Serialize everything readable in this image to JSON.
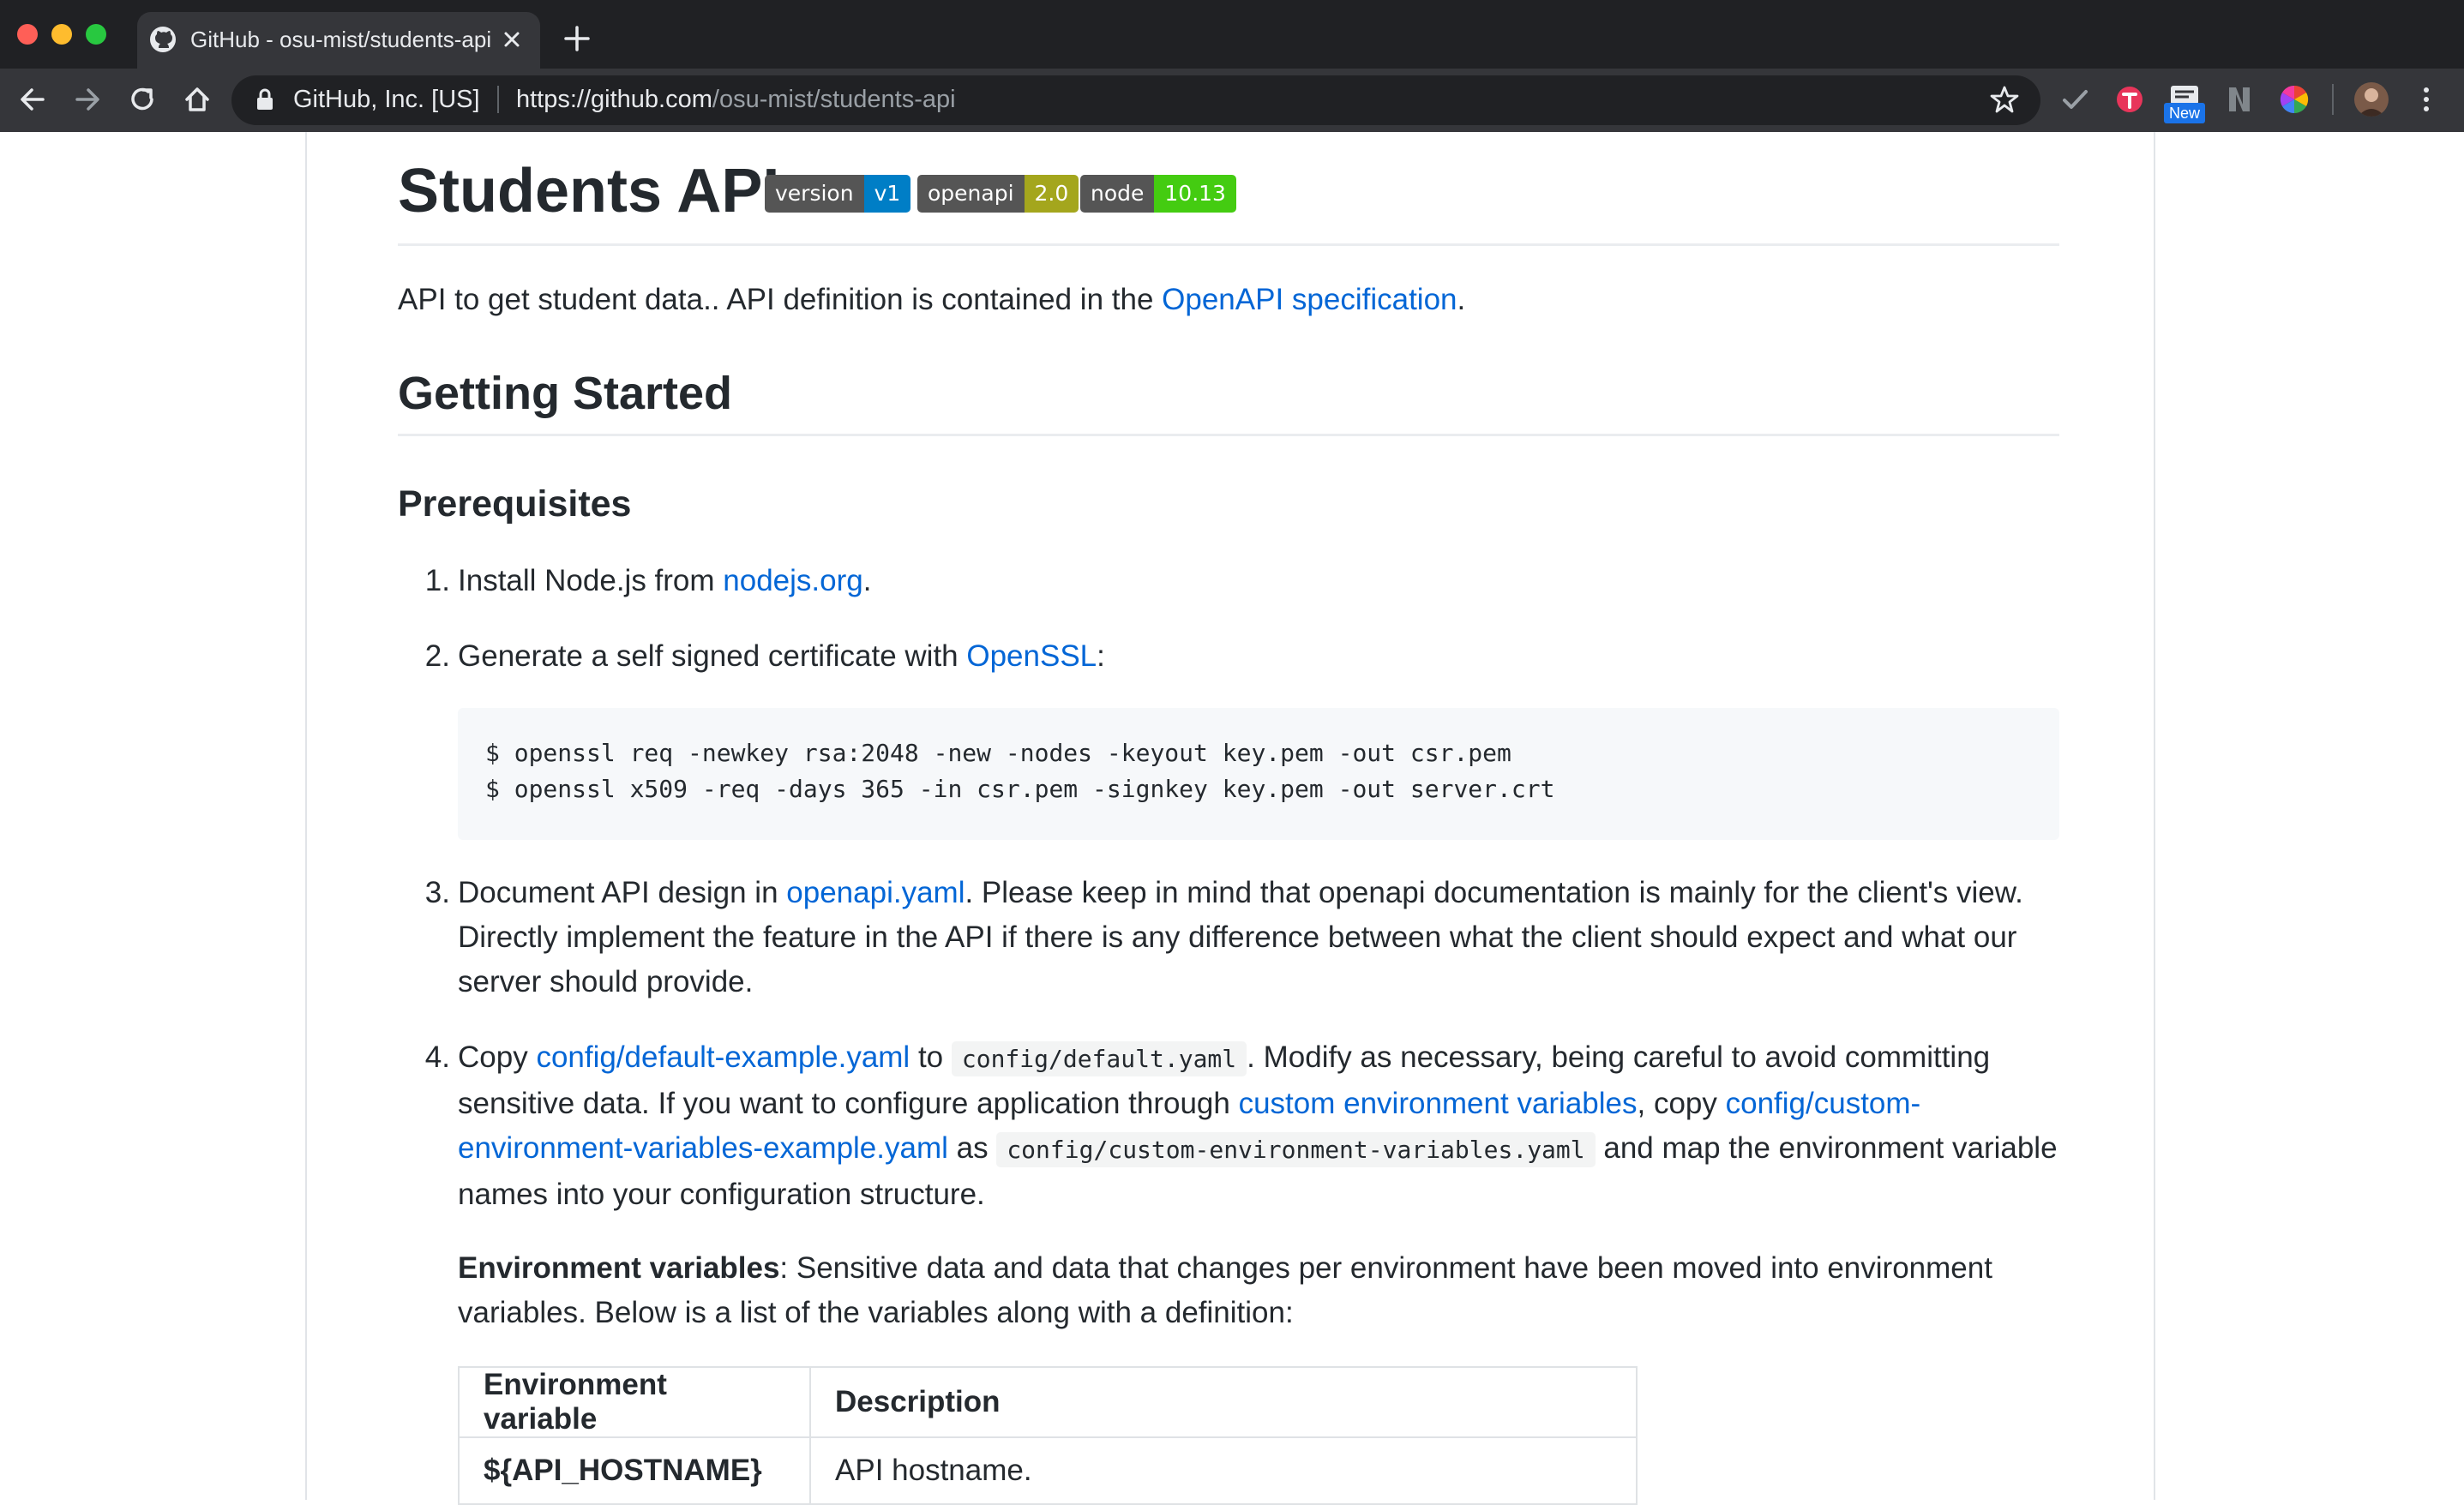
{
  "browser": {
    "tab": {
      "title": "GitHub - osu-mist/students-api"
    },
    "site_identity": "GitHub, Inc. [US]",
    "url": {
      "scheme_host": "https://github.com",
      "path": "/osu-mist/students-api"
    },
    "extensions": [
      {
        "icon": "check-extension-icon"
      },
      {
        "icon": "red-circle-extension-icon"
      },
      {
        "icon": "new-extension-icon",
        "badge": "New"
      },
      {
        "icon": "n-extension-icon"
      },
      {
        "icon": "color-wheel-extension-icon"
      }
    ],
    "colors": {
      "frame": "#202124",
      "toolbar": "#35363a"
    }
  },
  "readme": {
    "title": "Students API",
    "badges": [
      {
        "label": "version",
        "value": "v1",
        "color": "#007ec6"
      },
      {
        "label": "openapi",
        "value": "2.0",
        "color": "#a4a61d"
      },
      {
        "label": "node",
        "value": "10.13",
        "color": "#4c1"
      }
    ],
    "intro": {
      "text": "API to get student data.. API definition is contained in the ",
      "link": "OpenAPI specification",
      "after": "."
    },
    "getting_started": "Getting Started",
    "prerequisites": "Prerequisites",
    "steps": [
      {
        "num": "1.",
        "pre": "Install Node.js from ",
        "link": "nodejs.org",
        "post": "."
      },
      {
        "num": "2.",
        "pre": "Generate a self signed certificate with ",
        "link": "OpenSSL",
        "post": ":"
      },
      {
        "num": "3.",
        "pre": "Document API design in ",
        "link": "openapi.yaml",
        "line1": ". Please keep in mind that openapi documentation is mainly for the client's view.",
        "line2": "Directly implement the feature in the API if there is any difference between what the client should expect and what our",
        "line3": "server should provide."
      },
      {
        "num": "4.",
        "pre": "Copy ",
        "link1": "config/default-example.yaml",
        "to": " to ",
        "code1": "config/default.yaml",
        "line1_post": ". Modify as necessary, being careful to avoid committing",
        "line2_pre": "sensitive data. If you want to configure application through ",
        "link2": "custom environment variables",
        "line2_mid": ", copy ",
        "link3a": "config/custom-",
        "link3b": "environment-variables-example.yaml",
        "as": " as ",
        "code2": "config/custom-environment-variables.yaml",
        "line3_post": " and map the environment variable",
        "line4": "names into your configuration structure."
      }
    ],
    "code_block": [
      "$ openssl req -newkey rsa:2048 -new -nodes -keyout key.pem -out csr.pem",
      "$ openssl x509 -req -days 365 -in csr.pem -signkey key.pem -out server.crt"
    ],
    "env": {
      "label": "Environment variables",
      "line1": ": Sensitive data and data that changes per environment have been moved into environment",
      "line2": "variables. Below is a list of the variables along with a definition:"
    },
    "table": {
      "headers": [
        "Environment variable",
        "Description"
      ],
      "rows": [
        [
          "${API_HOSTNAME}",
          "API hostname."
        ]
      ]
    },
    "colors": {
      "link": "#0366d6",
      "text": "#24292e"
    }
  }
}
